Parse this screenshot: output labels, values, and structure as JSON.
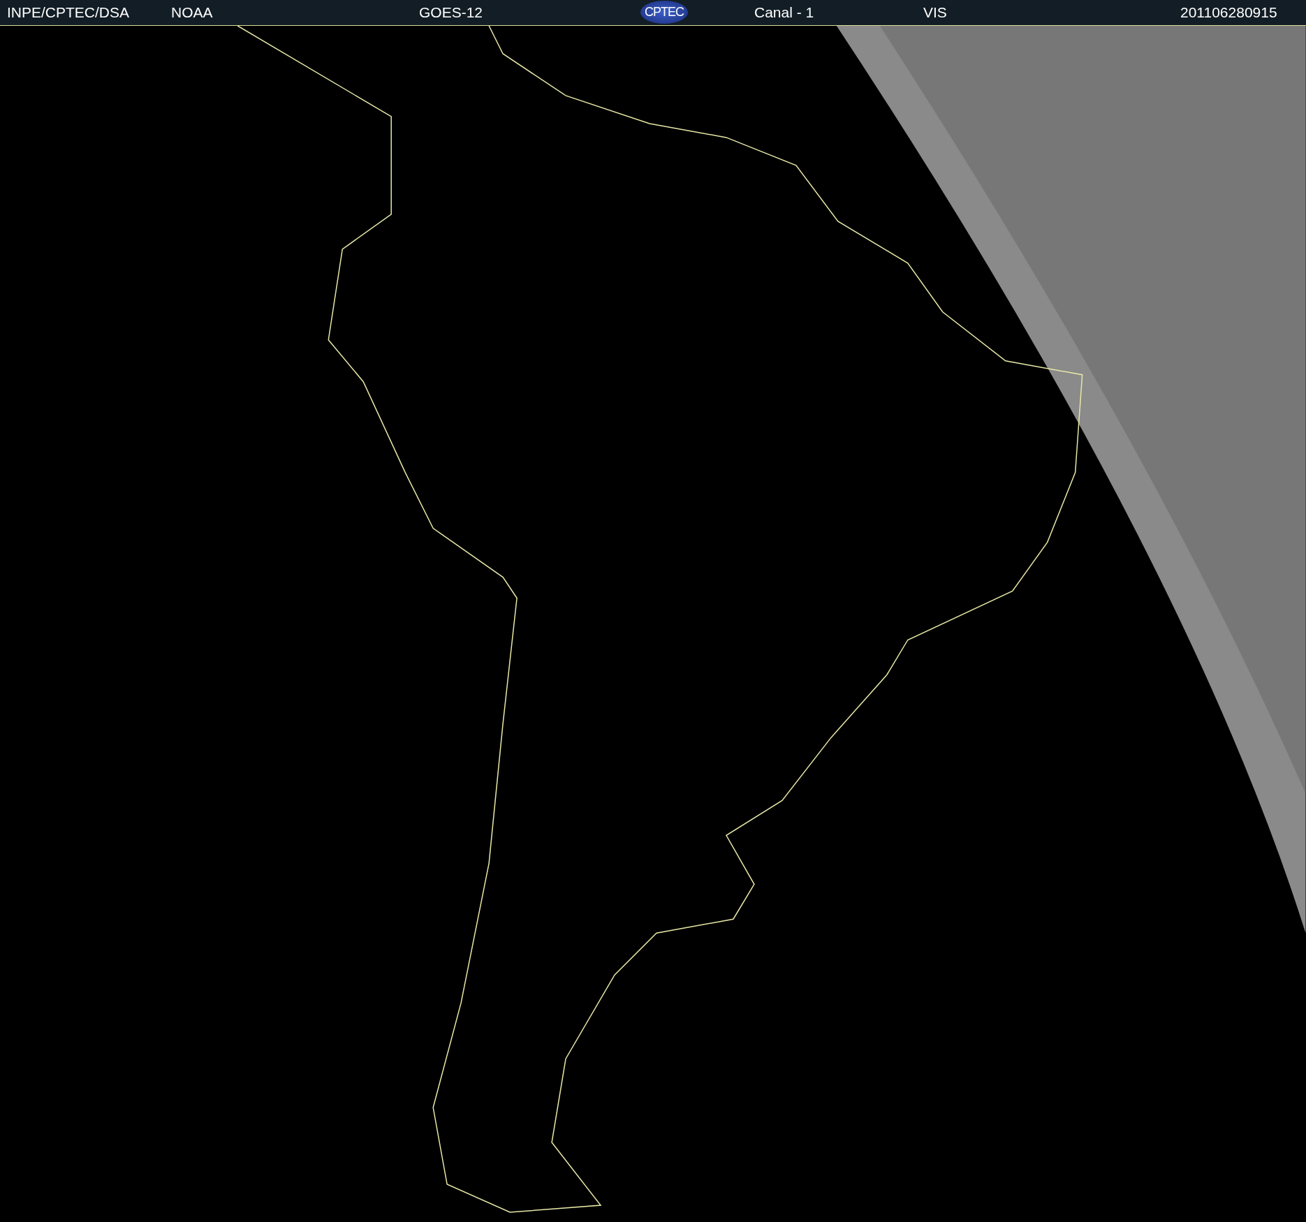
{
  "header": {
    "items": [
      {
        "kind": "text",
        "text": "INPE/CPTEC/DSA"
      },
      {
        "kind": "text",
        "text": "NOAA"
      },
      {
        "kind": "text",
        "text": "GOES-12"
      },
      {
        "kind": "logo",
        "text": "CPTEC"
      },
      {
        "kind": "text",
        "text": "Canal - 1"
      },
      {
        "kind": "text",
        "text": "VIS"
      },
      {
        "kind": "text",
        "text": "201106280915"
      }
    ]
  }
}
